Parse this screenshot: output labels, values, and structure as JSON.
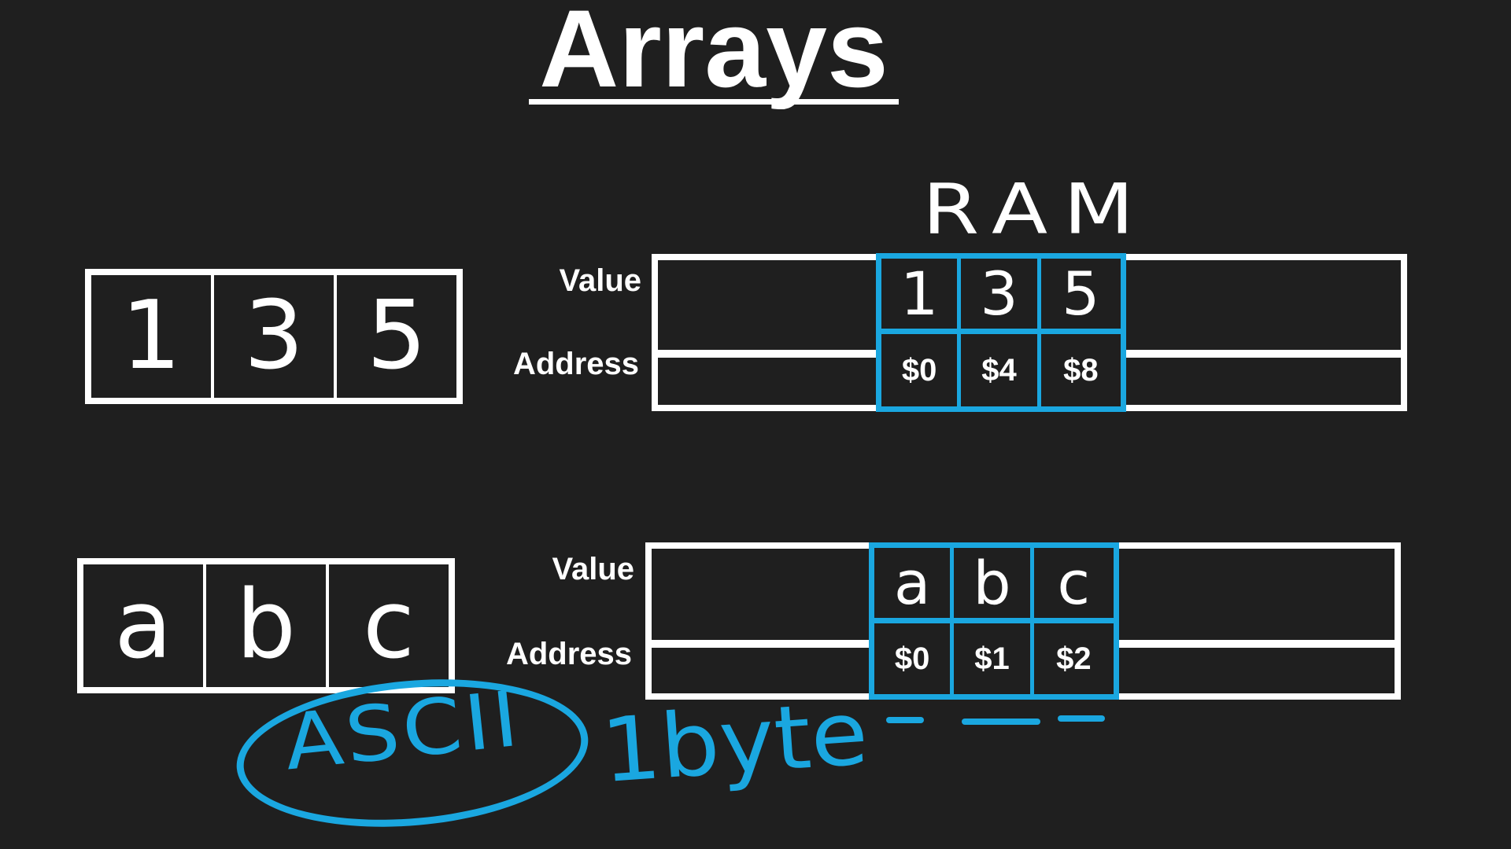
{
  "title": "Arrays",
  "ram_label": "RAM",
  "int_array": {
    "values": [
      "1",
      "3",
      "5"
    ],
    "ram": {
      "value_label": "Value",
      "address_label": "Address",
      "addresses": [
        "$0",
        "$4",
        "$8"
      ]
    }
  },
  "char_array": {
    "values": [
      "a",
      "b",
      "c"
    ],
    "ram": {
      "value_label": "Value",
      "address_label": "Address",
      "addresses": [
        "$0",
        "$1",
        "$2"
      ]
    }
  },
  "annotations": {
    "ascii": "ASCII",
    "size": "1byte"
  },
  "colors": {
    "background": "#1f1f1f",
    "foreground": "#ffffff",
    "highlight": "#1aa7e0"
  }
}
